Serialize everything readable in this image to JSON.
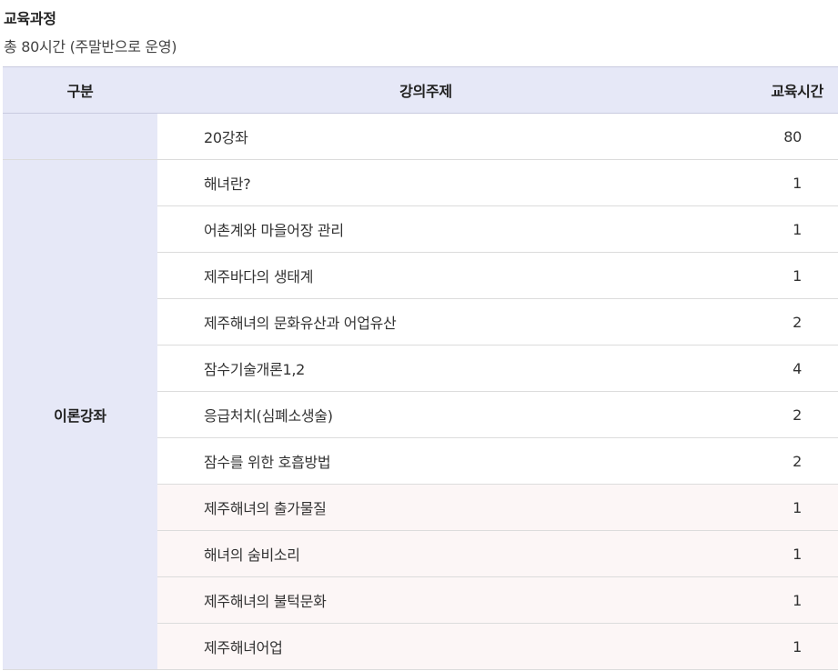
{
  "title": "교육과정",
  "subtitle": "총 80시간 (주말반으로 운영)",
  "table": {
    "headers": {
      "category": "구분",
      "topic": "강의주제",
      "hours": "교육시간"
    },
    "summary_row": {
      "category": "",
      "topic": "20강좌",
      "hours": "80"
    },
    "category_label": "이론강좌",
    "rows": [
      {
        "topic": "해녀란?",
        "hours": "1"
      },
      {
        "topic": "어촌계와 마을어장 관리",
        "hours": "1"
      },
      {
        "topic": "제주바다의 생태계",
        "hours": "1"
      },
      {
        "topic": "제주해녀의 문화유산과 어업유산",
        "hours": "2"
      },
      {
        "topic": "잠수기술개론1,2",
        "hours": "4"
      },
      {
        "topic": "응급처치(심폐소생술)",
        "hours": "2"
      },
      {
        "topic": "잠수를 위한 호흡방법",
        "hours": "2"
      },
      {
        "topic": "제주해녀의 출가물질",
        "hours": "1"
      },
      {
        "topic": "해녀의 숨비소리",
        "hours": "1"
      },
      {
        "topic": "제주해녀의 불턱문화",
        "hours": "1"
      },
      {
        "topic": "제주해녀어업",
        "hours": "1"
      }
    ]
  },
  "colors": {
    "header_bg": "#e6e8f7",
    "highlight_row_bg": "#fcf6f6",
    "border": "#dcdcdc"
  }
}
